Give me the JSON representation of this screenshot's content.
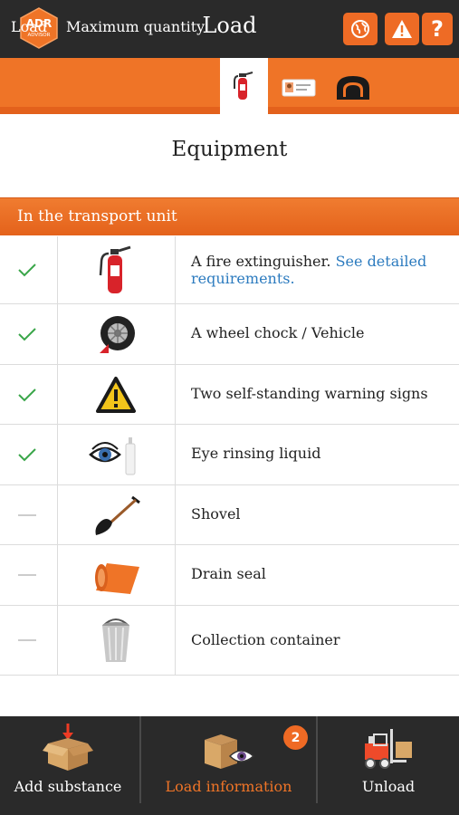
{
  "header": {
    "logo_text_top": "ADR",
    "logo_text_bottom": "ADVISOR",
    "title": "Load",
    "help_label": "?"
  },
  "tabs": {
    "load": "Load",
    "max_quantity": "Maximum quantity",
    "icons": [
      "fire-extinguisher-icon",
      "id-card-icon",
      "tunnel-icon"
    ]
  },
  "section_title": "Equipment",
  "subheader": "In the transport unit",
  "equipment": [
    {
      "status": "check",
      "icon": "fire-extinguisher-icon",
      "text": "A fire extinguisher.",
      "link": "See detailed requirements."
    },
    {
      "status": "check",
      "icon": "wheel-chock-icon",
      "text": "A wheel chock / Vehicle"
    },
    {
      "status": "check",
      "icon": "warning-sign-icon",
      "text": "Two self-standing warning signs"
    },
    {
      "status": "check",
      "icon": "eye-rinse-icon",
      "text": "Eye rinsing liquid"
    },
    {
      "status": "dash",
      "icon": "shovel-icon",
      "text": "Shovel"
    },
    {
      "status": "dash",
      "icon": "drain-seal-icon",
      "text": "Drain seal"
    },
    {
      "status": "dash",
      "icon": "bucket-icon",
      "text": "Collection container"
    }
  ],
  "bottom_nav": {
    "add_substance": "Add substance",
    "load_information": "Load information",
    "load_information_badge": "2",
    "unload": "Unload"
  },
  "colors": {
    "accent": "#ef7427",
    "dark_bar": "#2a2a2a",
    "check": "#3aa64a",
    "link": "#2c7bbf"
  }
}
